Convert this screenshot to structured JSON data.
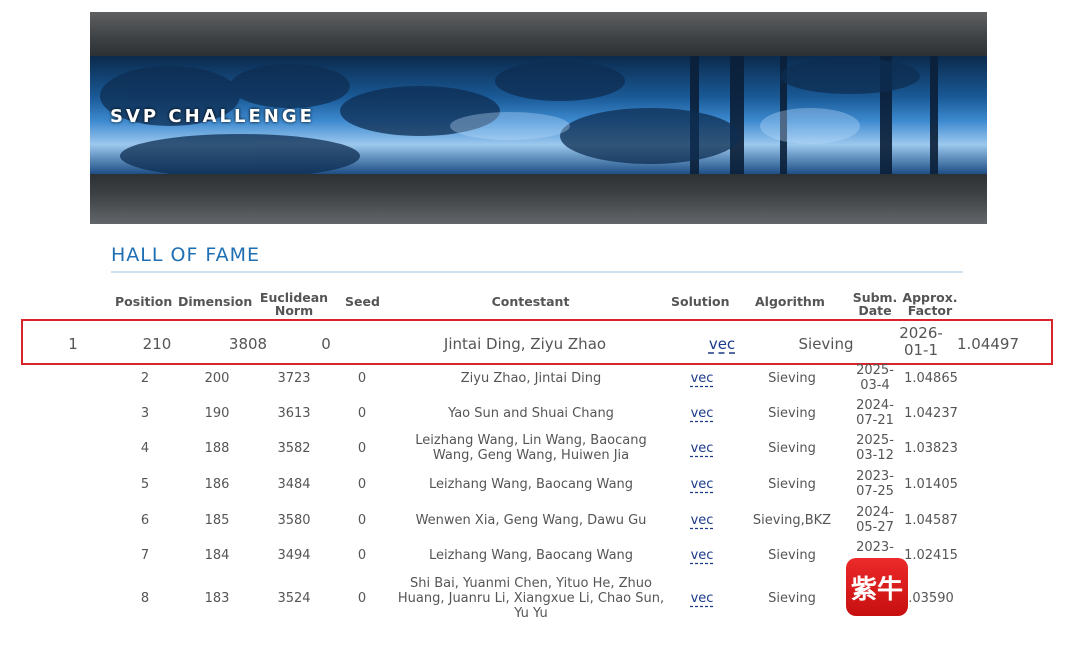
{
  "banner": {
    "title": "SVP CHALLENGE"
  },
  "section": {
    "title": "HALL OF FAME"
  },
  "columns": [
    "Position",
    "Dimension",
    "Euclidean Norm",
    "Seed",
    "Contestant",
    "Solution",
    "Algorithm",
    "Subm. Date",
    "Approx. Factor"
  ],
  "highlighted_row": {
    "position": "1",
    "dimension": "210",
    "norm": "3808",
    "seed": "0",
    "contestant": "Jintai Ding, Ziyu Zhao",
    "solution": "vec",
    "algorithm": "Sieving",
    "date_line1": "2026-",
    "date_line2": "01-1",
    "factor": "1.04497"
  },
  "rows": [
    {
      "position": "2",
      "dimension": "200",
      "norm": "3723",
      "seed": "0",
      "contestant": [
        "Ziyu Zhao, Jintai Ding"
      ],
      "solution": "vec",
      "algorithm": "Sieving",
      "date": [
        "2025-",
        "03-4"
      ],
      "factor": "1.04865"
    },
    {
      "position": "3",
      "dimension": "190",
      "norm": "3613",
      "seed": "0",
      "contestant": [
        "Yao Sun and Shuai Chang"
      ],
      "solution": "vec",
      "algorithm": "Sieving",
      "date": [
        "2024-",
        "07-21"
      ],
      "factor": "1.04237"
    },
    {
      "position": "4",
      "dimension": "188",
      "norm": "3582",
      "seed": "0",
      "contestant": [
        "Leizhang Wang, Lin Wang, Baocang",
        "Wang, Geng Wang, Huiwen Jia"
      ],
      "solution": "vec",
      "algorithm": "Sieving",
      "date": [
        "2025-",
        "03-12"
      ],
      "factor": "1.03823"
    },
    {
      "position": "5",
      "dimension": "186",
      "norm": "3484",
      "seed": "0",
      "contestant": [
        "Leizhang Wang, Baocang Wang"
      ],
      "solution": "vec",
      "algorithm": "Sieving",
      "date": [
        "2023-",
        "07-25"
      ],
      "factor": "1.01405"
    },
    {
      "position": "6",
      "dimension": "185",
      "norm": "3580",
      "seed": "0",
      "contestant": [
        "Wenwen Xia, Geng Wang, Dawu Gu"
      ],
      "solution": "vec",
      "algorithm": "Sieving,BKZ",
      "date": [
        "2024-",
        "05-27"
      ],
      "factor": "1.04587"
    },
    {
      "position": "7",
      "dimension": "184",
      "norm": "3494",
      "seed": "0",
      "contestant": [
        "Leizhang Wang, Baocang Wang"
      ],
      "solution": "vec",
      "algorithm": "Sieving",
      "date": [
        "2023-",
        ""
      ],
      "factor": "1.02415"
    },
    {
      "position": "8",
      "dimension": "183",
      "norm": "3524",
      "seed": "0",
      "contestant": [
        "Shi Bai, Yuanmi Chen, Yituo He, Zhuo",
        "Huang, Juanru Li, Xiangxue Li, Chao Sun,",
        "Yu Yu"
      ],
      "solution": "vec",
      "algorithm": "Sieving",
      "date": [
        "",
        ""
      ],
      "factor": ".03590"
    }
  ],
  "watermark": {
    "text": "紫牛"
  },
  "colors": {
    "accent": "#1f6fb4",
    "highlight_border": "#d6262c",
    "link": "#1b3a8a",
    "badge": "#e01e1e"
  }
}
